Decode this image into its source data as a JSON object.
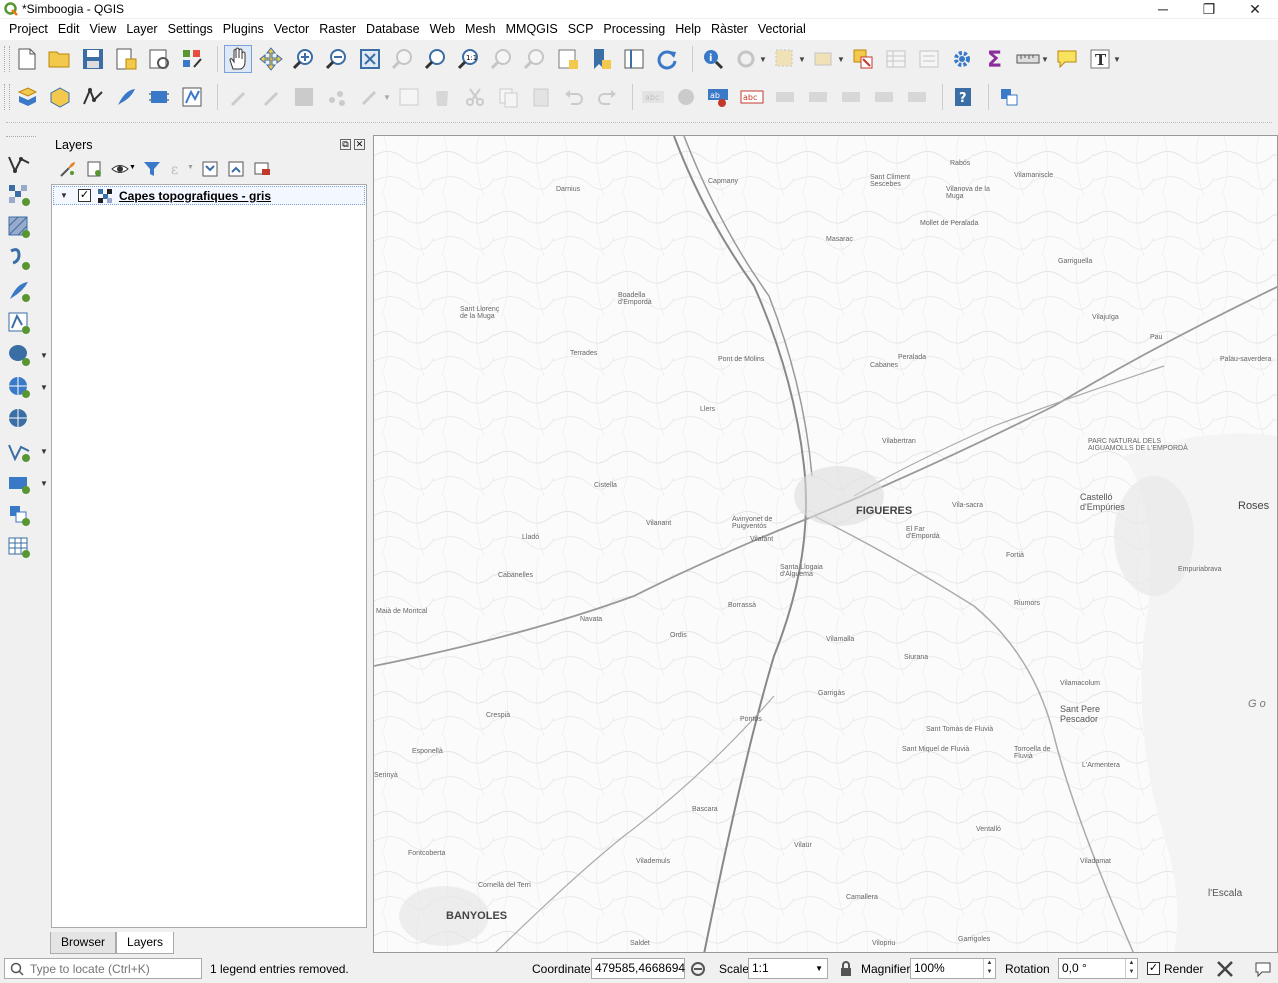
{
  "window": {
    "title": "*Simboogia - QGIS",
    "minimize_glyph": "─",
    "restore_glyph": "❐",
    "close_glyph": "✕"
  },
  "menu": [
    "Project",
    "Edit",
    "View",
    "Layer",
    "Settings",
    "Plugins",
    "Vector",
    "Raster",
    "Database",
    "Web",
    "Mesh",
    "MMQGIS",
    "SCP",
    "Processing",
    "Help",
    "Ràster",
    "Vectorial"
  ],
  "layers_panel": {
    "title": "Layers",
    "layer": {
      "name": "Capes topografiques - gris",
      "checked": "✓",
      "expander": "▼"
    },
    "tabs": [
      "Browser",
      "Layers"
    ],
    "active_tab": "Layers"
  },
  "map": {
    "labels": [
      "FIGUERES",
      "BANYOLES",
      "Roses",
      "Castelló d'Empúries",
      "PARC NATURAL DELS AIGUAMOLLS DE L'EMPORDÀ",
      "Sant Pere Pescador",
      "l'Escala",
      "Vilafant",
      "Avinyonet de Puigventós",
      "Cistella",
      "Terrades",
      "Darnius",
      "Capmany",
      "Peralada",
      "Vilabertran",
      "Llers",
      "Crespià",
      "Esponellà",
      "Cabanelles",
      "Navata",
      "Ordis",
      "Borrassà",
      "Santa Llogaia d'Àlguema",
      "Vilamalla",
      "Siurana",
      "Torroella de Fluvià",
      "Vilamacolum",
      "Sant Miquel de Fluvià",
      "Vilaür",
      "Vilademuls",
      "Bascara",
      "Pontos",
      "Garrigàs",
      "Cabanes",
      "Vilanant",
      "Lladó",
      "Sant Llorenç de la Muga",
      "Boadella d'Empordà",
      "Pont de Molins",
      "Masarac",
      "Mollet de Peralada",
      "Garriguella",
      "Vilajuïga",
      "Pau",
      "Palau-saverdera",
      "Fortià",
      "Riumors",
      "Vila-sacra",
      "El Far d'Empordà",
      "Empuriabrava",
      "Ventalló",
      "Viladamat",
      "Cornellà del Terri",
      "Fontcoberta",
      "Serinyà",
      "Maià de Montcal",
      "Sant Climent Sescebes",
      "Vilamaniscle",
      "Rabós",
      "Vilanova de la Muga",
      "Garrigoles",
      "Camallera",
      "Vilopriu",
      "Saldet",
      "Sant Tomàs de Fluvià",
      "L'Armentera",
      "G o"
    ]
  },
  "status": {
    "locator_placeholder": "Type to locate (Ctrl+K)",
    "message": "1 legend entries removed.",
    "coordinate_label": "Coordinate",
    "coordinate_value": "479585,4668694",
    "scale_label": "Scale",
    "scale_value": "1:1",
    "magnifier_label": "Magnifier",
    "magnifier_value": "100%",
    "rotation_label": "Rotation",
    "rotation_value": "0,0 °",
    "render_label": "Render",
    "render_checked": "✓"
  },
  "colors": {
    "accent": "#3a78c8",
    "qgis_green": "#589632",
    "sum_purple": "#8c2d9e"
  }
}
